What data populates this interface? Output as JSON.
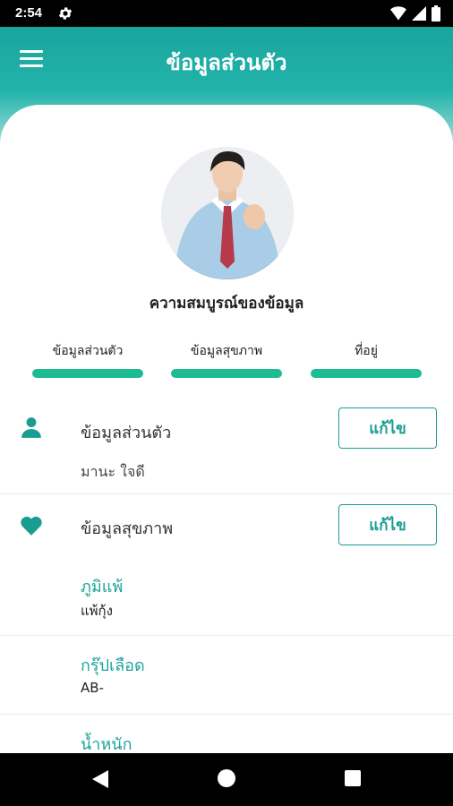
{
  "status_bar": {
    "time": "2:54"
  },
  "header": {
    "title": "ข้อมูลส่วนตัว"
  },
  "profile": {
    "completeness_label": "ความสมบูรณ์ของข้อมูล"
  },
  "tabs": [
    {
      "label": "ข้อมูลส่วนตัว",
      "progress": 1.0
    },
    {
      "label": "ข้อมูลสุขภาพ",
      "progress": 1.0
    },
    {
      "label": "ที่อยู่",
      "progress": 1.0
    }
  ],
  "personal": {
    "title": "ข้อมูลส่วนตัว",
    "edit_label": "แก้ไข",
    "name": "มานะ ใจดี"
  },
  "health": {
    "title": "ข้อมูลสุขภาพ",
    "edit_label": "แก้ไข",
    "fields": [
      {
        "label": "ภูมิแพ้",
        "value": "แพ้กุ้ง"
      },
      {
        "label": "กรุ๊ปเลือด",
        "value": "AB-"
      },
      {
        "label": "น้ำหนัก",
        "value": ""
      }
    ]
  },
  "colors": {
    "accent": "#1a9c93",
    "progress": "#1dbb94",
    "header_top": "#1aa59f"
  },
  "icons": [
    "settings-icon",
    "wifi-icon",
    "signal-icon",
    "battery-icon",
    "menu-icon",
    "person-icon",
    "heart-icon",
    "back-icon",
    "home-icon",
    "recent-apps-icon"
  ]
}
